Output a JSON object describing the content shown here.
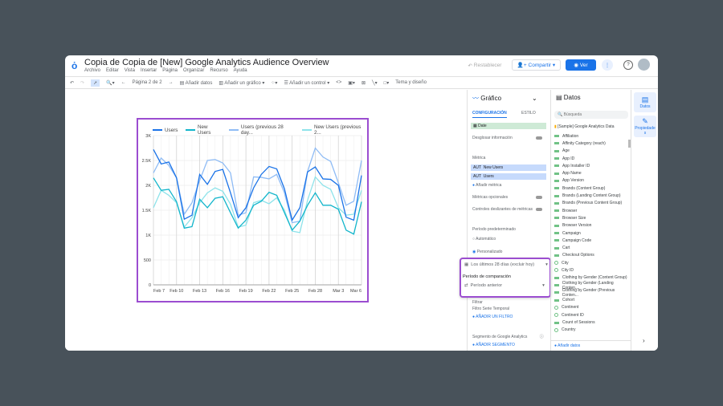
{
  "app": {
    "title": "Copia de Copia de [New] Google Analytics Audience Overview",
    "menu": [
      "Archivo",
      "Editar",
      "Vista",
      "Insertar",
      "Página",
      "Organizar",
      "Recurso",
      "Ayuda"
    ],
    "restore": "Restablecer",
    "share": "Compartir",
    "view": "Ver"
  },
  "toolbar": {
    "page": "Página 2 de 2",
    "add_data": "Añadir datos",
    "add_chart": "Añadir un gráfico",
    "add_control": "Añadir un control",
    "theme": "Tema y diseño"
  },
  "config": {
    "chart_type": "Gráfico",
    "tab_config": "CONFIGURACIÓN",
    "tab_style": "ESTILO",
    "dimension": "Date",
    "drill": "Desglosar información",
    "metric_label": "Métrica",
    "metrics": [
      "New Users",
      "Users"
    ],
    "metric_prefix": "AUT",
    "add_metric": "Añadir métrica",
    "optional_metrics": "Métricas opcionales",
    "sliders": "Controles deslizantes de métricas",
    "default_period": "Período predeterminado",
    "auto": "Automático",
    "custom": "Personalizado",
    "date_range": "Los últimos 28 días (excluir hoy)",
    "comparison_label": "Período de comparación",
    "comparison": "Período anterior",
    "filter": "Filtrar",
    "filter_sub": "Filtro Serie Temporal",
    "add_filter": "AÑADIR UN FILTRO",
    "segment": "Segmento de Google Analytics",
    "add_segment": "AÑADIR SEGMENTO"
  },
  "data": {
    "title": "Datos",
    "search": "Búsqueda",
    "source": "[Sample] Google Analytics Data",
    "fields": [
      "Affiliation",
      "Affinity Category (reach)",
      "Age",
      "App ID",
      "App Installer ID",
      "App Name",
      "App Version",
      "Brands (Content Group)",
      "Brands (Landing Content Group)",
      "Brands (Previous Content Group)",
      "Browser",
      "Browser Size",
      "Browser Version",
      "Campaign",
      "Campaign Code",
      "Cart",
      "Checkout Options",
      "City",
      "City ID",
      "Clothing by Gender (Content Group)",
      "Clothing by Gender (Landing Conten...",
      "Clothing by Gender (Previous Conten...",
      "Cohort",
      "Continent",
      "Continent ID",
      "Count of Sessions",
      "Country"
    ],
    "geo": [
      17,
      18,
      23,
      24,
      26
    ],
    "add_data": "Añadir datos"
  },
  "rail": {
    "data": "Datos",
    "props": "Propiedades"
  },
  "chart_data": {
    "type": "line",
    "categories": [
      "Feb 7",
      "Feb 8",
      "Feb 9",
      "Feb 10",
      "Feb 11",
      "Feb 12",
      "Feb 13",
      "Feb 14",
      "Feb 15",
      "Feb 16",
      "Feb 17",
      "Feb 18",
      "Feb 19",
      "Feb 20",
      "Feb 21",
      "Feb 22",
      "Feb 23",
      "Feb 24",
      "Feb 25",
      "Feb 26",
      "Feb 27",
      "Feb 28",
      "Mar 1",
      "Mar 2",
      "Mar 3",
      "Mar 4",
      "Mar 5",
      "Mar 6"
    ],
    "xticks": [
      "Feb 7",
      "Feb 10",
      "Feb 13",
      "Feb 16",
      "Feb 19",
      "Feb 22",
      "Feb 25",
      "Feb 28",
      "Mar 3",
      "Mar 6"
    ],
    "yticks": [
      "0",
      "500",
      "1K",
      "1.5K",
      "2K",
      "2.5K",
      "3K"
    ],
    "ylim": [
      0,
      3000
    ],
    "series": [
      {
        "name": "Users",
        "color": "#1a73e8",
        "values": [
          2720,
          2430,
          2470,
          2150,
          1320,
          1400,
          2220,
          2020,
          2280,
          2320,
          1850,
          1350,
          1550,
          1950,
          2220,
          2380,
          2330,
          1930,
          1300,
          1550,
          2270,
          2370,
          2130,
          2120,
          2000,
          1360,
          1300,
          2200
        ]
      },
      {
        "name": "New Users",
        "color": "#12b5cb",
        "values": [
          2150,
          1900,
          1920,
          1670,
          1140,
          1170,
          1720,
          1550,
          1740,
          1770,
          1450,
          1140,
          1300,
          1600,
          1680,
          1860,
          1800,
          1450,
          1100,
          1280,
          1600,
          1850,
          1600,
          1600,
          1520,
          1100,
          1020,
          1670
        ]
      },
      {
        "name": "Users (previous 28 day...",
        "color": "#8fbcf5",
        "values": [
          2250,
          2550,
          2400,
          2150,
          1420,
          1650,
          2100,
          2500,
          2520,
          2450,
          2250,
          1400,
          1450,
          2170,
          2160,
          2130,
          2220,
          1850,
          1250,
          1280,
          2280,
          2750,
          2570,
          2480,
          2050,
          1600,
          1680,
          2500
        ]
      },
      {
        "name": "New Users (previous 2...",
        "color": "#8ee3ea",
        "values": [
          1550,
          1900,
          1800,
          1650,
          1160,
          1350,
          1650,
          1850,
          1950,
          1880,
          1620,
          1160,
          1200,
          1650,
          1700,
          1630,
          1750,
          1500,
          1080,
          1050,
          1700,
          2170,
          2000,
          1920,
          1550,
          1400,
          1420,
          1900
        ]
      }
    ]
  }
}
